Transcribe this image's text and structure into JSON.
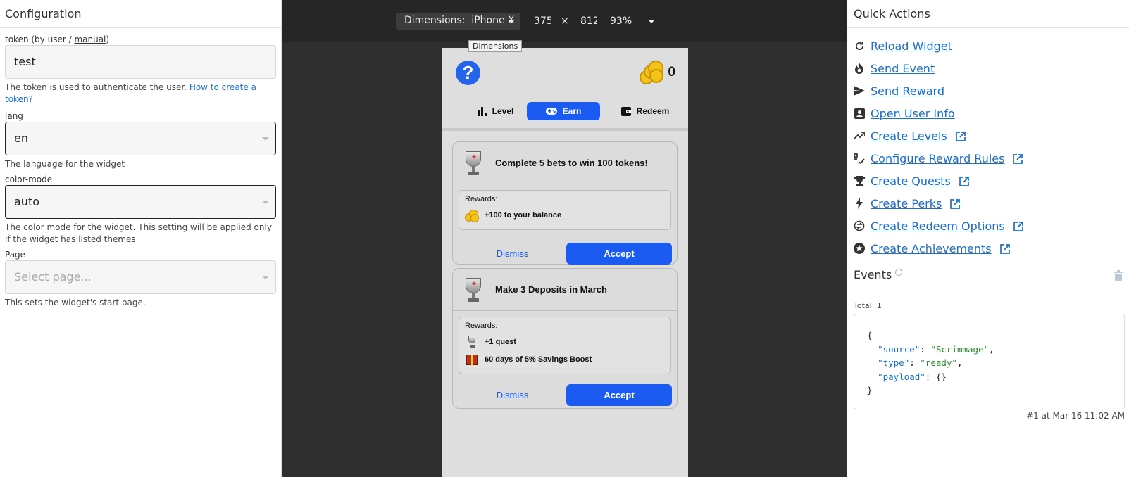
{
  "config": {
    "title": "Configuration",
    "token": {
      "label_prefix": "token (by user / ",
      "label_link": "manual",
      "label_suffix": ")",
      "value": "test",
      "hint_text": "The token is used to authenticate the user.",
      "hint_link": "How to create a token?"
    },
    "lang": {
      "label": "lang",
      "value": "en",
      "hint": "The language for the widget"
    },
    "color_mode": {
      "label": "color-mode",
      "value": "auto",
      "hint": "The color mode for the widget. This setting will be applied only if the widget has listed themes"
    },
    "page": {
      "label": "Page",
      "placeholder": "Select page...",
      "hint": "This sets the widget's start page."
    }
  },
  "toolbar": {
    "dimensions_label": "Dimensions:",
    "dimensions_value": "iPhone X",
    "width": "375",
    "times": "×",
    "height": "812",
    "zoom": "93%",
    "tooltip": "Dimensions"
  },
  "widget": {
    "help": "?",
    "coin_count": "0",
    "tabs": [
      {
        "label": "Level",
        "icon": "bar-chart-icon"
      },
      {
        "label": "Earn",
        "icon": "gamepad-icon"
      },
      {
        "label": "Redeem",
        "icon": "wallet-icon"
      }
    ],
    "quests": [
      {
        "title": "Complete 5 bets to win 100 tokens!",
        "rewards_label": "Rewards:",
        "rewards": [
          {
            "icon": "coins-icon",
            "text": "+100 to your balance"
          }
        ],
        "dismiss": "Dismiss",
        "accept": "Accept"
      },
      {
        "title": "Make 3 Deposits in March",
        "rewards_label": "Rewards:",
        "rewards": [
          {
            "icon": "trophy-icon",
            "text": "+1 quest"
          },
          {
            "icon": "gift-icon",
            "text": "60 days of 5% Savings Boost"
          }
        ],
        "dismiss": "Dismiss",
        "accept": "Accept"
      }
    ]
  },
  "quick_actions": {
    "title": "Quick Actions",
    "items": [
      {
        "label": "Reload Widget",
        "icon": "reload-icon",
        "external": false
      },
      {
        "label": "Send Event",
        "icon": "fire-icon",
        "external": false
      },
      {
        "label": "Send Reward",
        "icon": "send-icon",
        "external": false
      },
      {
        "label": "Open User Info",
        "icon": "user-card-icon",
        "external": false
      },
      {
        "label": "Create Levels",
        "icon": "trending-up-icon",
        "external": true
      },
      {
        "label": "Configure Reward Rules",
        "icon": "rules-icon",
        "external": true
      },
      {
        "label": "Create Quests",
        "icon": "trophy-icon",
        "external": true
      },
      {
        "label": "Create Perks",
        "icon": "bolt-icon",
        "external": true
      },
      {
        "label": "Create Redeem Options",
        "icon": "exchange-icon",
        "external": true
      },
      {
        "label": "Create Achievements",
        "icon": "star-badge-icon",
        "external": true
      }
    ]
  },
  "events": {
    "title": "Events",
    "total": "Total: 1",
    "code_lines": [
      "{",
      "  \"source\": \"Scrimmage\",",
      "  \"type\": \"ready\",",
      "  \"payload\": {}",
      "}"
    ],
    "meta": "#1 at Mar 16 11:02 AM"
  },
  "colors": {
    "accent": "#1c5bf2",
    "link": "#1a6fc7",
    "dark_bg": "#2f2f2f"
  }
}
